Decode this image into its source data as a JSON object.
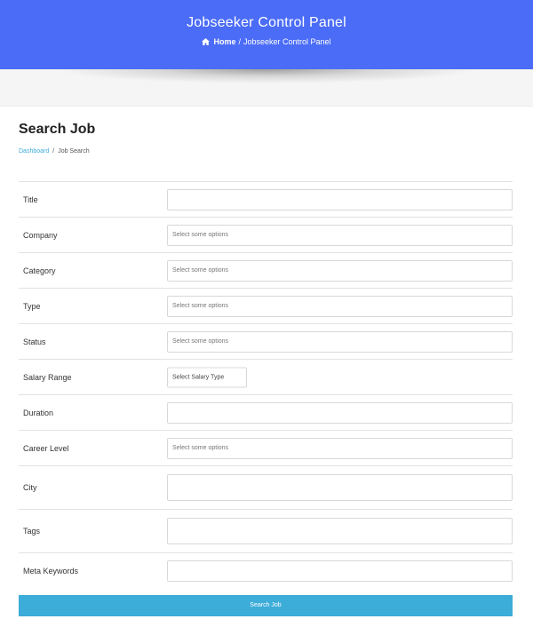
{
  "header": {
    "title": "Jobseeker Control Panel",
    "breadcrumb": {
      "home": "Home",
      "separator": "/",
      "current": "Jobseeker Control Panel"
    },
    "background_color": "#4b6cf6"
  },
  "page": {
    "title": "Search Job",
    "breadcrumb": {
      "link": "Dashboard",
      "separator": "/",
      "current": "Job Search"
    }
  },
  "form": {
    "fields": [
      {
        "label": "Title",
        "value": ""
      },
      {
        "label": "Company",
        "placeholder": "Select some options"
      },
      {
        "label": "Category",
        "placeholder": "Select some options"
      },
      {
        "label": "Type",
        "placeholder": "Select some options"
      },
      {
        "label": "Status",
        "placeholder": "Select some options"
      },
      {
        "label": "Salary Range",
        "select": "Select Salary Type"
      },
      {
        "label": "Duration",
        "value": ""
      },
      {
        "label": "Career Level",
        "placeholder": "Select some options"
      },
      {
        "label": "City",
        "value": ""
      },
      {
        "label": "Tags",
        "value": ""
      },
      {
        "label": "Meta Keywords",
        "value": ""
      }
    ],
    "submit_label": "Search Job",
    "submit_color": "#3cacd8"
  }
}
